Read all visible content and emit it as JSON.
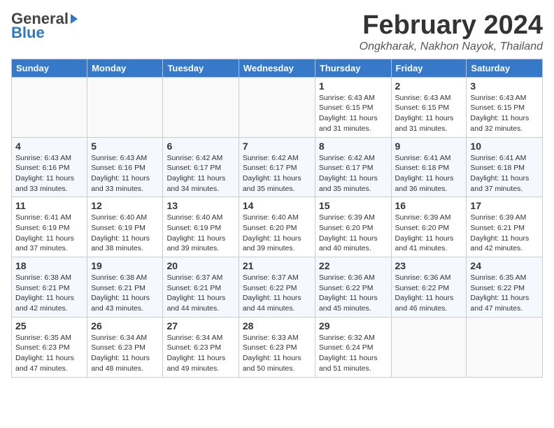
{
  "header": {
    "logo_general": "General",
    "logo_blue": "Blue",
    "month_year": "February 2024",
    "location": "Ongkharak, Nakhon Nayok, Thailand"
  },
  "days_of_week": [
    "Sunday",
    "Monday",
    "Tuesday",
    "Wednesday",
    "Thursday",
    "Friday",
    "Saturday"
  ],
  "weeks": [
    {
      "days": [
        {
          "number": "",
          "info": ""
        },
        {
          "number": "",
          "info": ""
        },
        {
          "number": "",
          "info": ""
        },
        {
          "number": "",
          "info": ""
        },
        {
          "number": "1",
          "info": "Sunrise: 6:43 AM\nSunset: 6:15 PM\nDaylight: 11 hours\nand 31 minutes."
        },
        {
          "number": "2",
          "info": "Sunrise: 6:43 AM\nSunset: 6:15 PM\nDaylight: 11 hours\nand 31 minutes."
        },
        {
          "number": "3",
          "info": "Sunrise: 6:43 AM\nSunset: 6:15 PM\nDaylight: 11 hours\nand 32 minutes."
        }
      ]
    },
    {
      "days": [
        {
          "number": "4",
          "info": "Sunrise: 6:43 AM\nSunset: 6:16 PM\nDaylight: 11 hours\nand 33 minutes."
        },
        {
          "number": "5",
          "info": "Sunrise: 6:43 AM\nSunset: 6:16 PM\nDaylight: 11 hours\nand 33 minutes."
        },
        {
          "number": "6",
          "info": "Sunrise: 6:42 AM\nSunset: 6:17 PM\nDaylight: 11 hours\nand 34 minutes."
        },
        {
          "number": "7",
          "info": "Sunrise: 6:42 AM\nSunset: 6:17 PM\nDaylight: 11 hours\nand 35 minutes."
        },
        {
          "number": "8",
          "info": "Sunrise: 6:42 AM\nSunset: 6:17 PM\nDaylight: 11 hours\nand 35 minutes."
        },
        {
          "number": "9",
          "info": "Sunrise: 6:41 AM\nSunset: 6:18 PM\nDaylight: 11 hours\nand 36 minutes."
        },
        {
          "number": "10",
          "info": "Sunrise: 6:41 AM\nSunset: 6:18 PM\nDaylight: 11 hours\nand 37 minutes."
        }
      ]
    },
    {
      "days": [
        {
          "number": "11",
          "info": "Sunrise: 6:41 AM\nSunset: 6:19 PM\nDaylight: 11 hours\nand 37 minutes."
        },
        {
          "number": "12",
          "info": "Sunrise: 6:40 AM\nSunset: 6:19 PM\nDaylight: 11 hours\nand 38 minutes."
        },
        {
          "number": "13",
          "info": "Sunrise: 6:40 AM\nSunset: 6:19 PM\nDaylight: 11 hours\nand 39 minutes."
        },
        {
          "number": "14",
          "info": "Sunrise: 6:40 AM\nSunset: 6:20 PM\nDaylight: 11 hours\nand 39 minutes."
        },
        {
          "number": "15",
          "info": "Sunrise: 6:39 AM\nSunset: 6:20 PM\nDaylight: 11 hours\nand 40 minutes."
        },
        {
          "number": "16",
          "info": "Sunrise: 6:39 AM\nSunset: 6:20 PM\nDaylight: 11 hours\nand 41 minutes."
        },
        {
          "number": "17",
          "info": "Sunrise: 6:39 AM\nSunset: 6:21 PM\nDaylight: 11 hours\nand 42 minutes."
        }
      ]
    },
    {
      "days": [
        {
          "number": "18",
          "info": "Sunrise: 6:38 AM\nSunset: 6:21 PM\nDaylight: 11 hours\nand 42 minutes."
        },
        {
          "number": "19",
          "info": "Sunrise: 6:38 AM\nSunset: 6:21 PM\nDaylight: 11 hours\nand 43 minutes."
        },
        {
          "number": "20",
          "info": "Sunrise: 6:37 AM\nSunset: 6:21 PM\nDaylight: 11 hours\nand 44 minutes."
        },
        {
          "number": "21",
          "info": "Sunrise: 6:37 AM\nSunset: 6:22 PM\nDaylight: 11 hours\nand 44 minutes."
        },
        {
          "number": "22",
          "info": "Sunrise: 6:36 AM\nSunset: 6:22 PM\nDaylight: 11 hours\nand 45 minutes."
        },
        {
          "number": "23",
          "info": "Sunrise: 6:36 AM\nSunset: 6:22 PM\nDaylight: 11 hours\nand 46 minutes."
        },
        {
          "number": "24",
          "info": "Sunrise: 6:35 AM\nSunset: 6:22 PM\nDaylight: 11 hours\nand 47 minutes."
        }
      ]
    },
    {
      "days": [
        {
          "number": "25",
          "info": "Sunrise: 6:35 AM\nSunset: 6:23 PM\nDaylight: 11 hours\nand 47 minutes."
        },
        {
          "number": "26",
          "info": "Sunrise: 6:34 AM\nSunset: 6:23 PM\nDaylight: 11 hours\nand 48 minutes."
        },
        {
          "number": "27",
          "info": "Sunrise: 6:34 AM\nSunset: 6:23 PM\nDaylight: 11 hours\nand 49 minutes."
        },
        {
          "number": "28",
          "info": "Sunrise: 6:33 AM\nSunset: 6:23 PM\nDaylight: 11 hours\nand 50 minutes."
        },
        {
          "number": "29",
          "info": "Sunrise: 6:32 AM\nSunset: 6:24 PM\nDaylight: 11 hours\nand 51 minutes."
        },
        {
          "number": "",
          "info": ""
        },
        {
          "number": "",
          "info": ""
        }
      ]
    }
  ]
}
